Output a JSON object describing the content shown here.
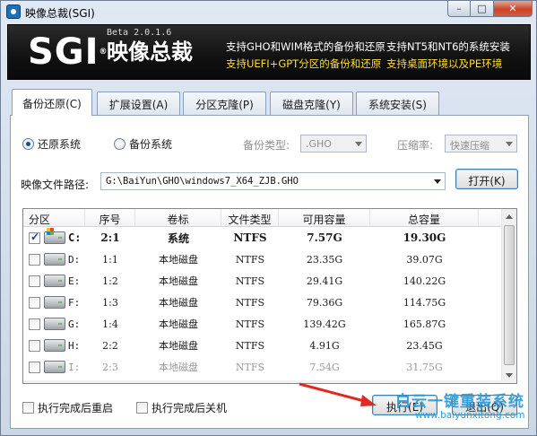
{
  "window": {
    "title": "映像总裁(SGI)",
    "controls": {
      "minimize": "–",
      "maximize": "□",
      "close": "✕"
    }
  },
  "banner": {
    "logo": "SGI",
    "logo_reg": "®",
    "name": "映像总裁",
    "version": "Beta 2.0.1.6",
    "features_white": [
      "支持GHO和WIM格式的备份和还原",
      "支持NT5和NT6的系统安装"
    ],
    "features_yellow": [
      "支持UEFI+GPT分区的备份和还原",
      "支持桌面环境以及PE环境"
    ]
  },
  "tabs": [
    {
      "label": "备份还原(C)",
      "active": true
    },
    {
      "label": "扩展设置(A)",
      "active": false
    },
    {
      "label": "分区克隆(P)",
      "active": false
    },
    {
      "label": "磁盘克隆(Y)",
      "active": false
    },
    {
      "label": "系统安装(S)",
      "active": false
    }
  ],
  "options": {
    "restore_label": "还原系统",
    "backup_label": "备份系统",
    "backup_type_label": "备份类型:",
    "backup_type_value": ".GHO",
    "compression_label": "压缩率:",
    "compression_value": "快速压缩"
  },
  "image_path": {
    "label": "映像文件路径:",
    "value": "G:\\BaiYun\\GHO\\windows7_X64_ZJB.GHO",
    "open_button": "打开(K)"
  },
  "table": {
    "headers": [
      "分区",
      "序号",
      "卷标",
      "文件类型",
      "可用容量",
      "总容量"
    ],
    "rows": [
      {
        "drive": "C:",
        "index": "2:1",
        "label": "系统",
        "fs": "NTFS",
        "free": "7.57G",
        "total": "19.30G",
        "checked": true,
        "bold": true,
        "system": true,
        "grey": false
      },
      {
        "drive": "D:",
        "index": "1:1",
        "label": "本地磁盘",
        "fs": "NTFS",
        "free": "23.35G",
        "total": "39.07G",
        "checked": false,
        "bold": false,
        "system": false,
        "grey": false
      },
      {
        "drive": "E:",
        "index": "1:2",
        "label": "本地磁盘",
        "fs": "NTFS",
        "free": "29.41G",
        "total": "140.22G",
        "checked": false,
        "bold": false,
        "system": false,
        "grey": false
      },
      {
        "drive": "F:",
        "index": "1:3",
        "label": "本地磁盘",
        "fs": "NTFS",
        "free": "79.36G",
        "total": "114.75G",
        "checked": false,
        "bold": false,
        "system": false,
        "grey": false
      },
      {
        "drive": "G:",
        "index": "1:4",
        "label": "本地磁盘",
        "fs": "NTFS",
        "free": "139.42G",
        "total": "165.87G",
        "checked": false,
        "bold": false,
        "system": false,
        "grey": false
      },
      {
        "drive": "H:",
        "index": "2:2",
        "label": "本地磁盘",
        "fs": "NTFS",
        "free": "4.91G",
        "total": "23.45G",
        "checked": false,
        "bold": false,
        "system": false,
        "grey": false
      },
      {
        "drive": "I:",
        "index": "2:3",
        "label": "本地磁盘",
        "fs": "NTFS",
        "free": "7.54G",
        "total": "31.75G",
        "checked": false,
        "bold": false,
        "system": false,
        "grey": true
      }
    ]
  },
  "footer": {
    "reboot_label": "执行完成后重启",
    "shutdown_label": "执行完成后关机",
    "execute_button": "执行(E)",
    "exit_button": "退出(Q)"
  },
  "watermark": {
    "line1": "白云一键重装系统",
    "line2": "www.baiyunxitong.com"
  },
  "colors": {
    "banner_bg": "#111111",
    "feature_yellow": "#ffde2a",
    "watermark": "#2a9ad8",
    "arrow": "#e02a1f"
  }
}
